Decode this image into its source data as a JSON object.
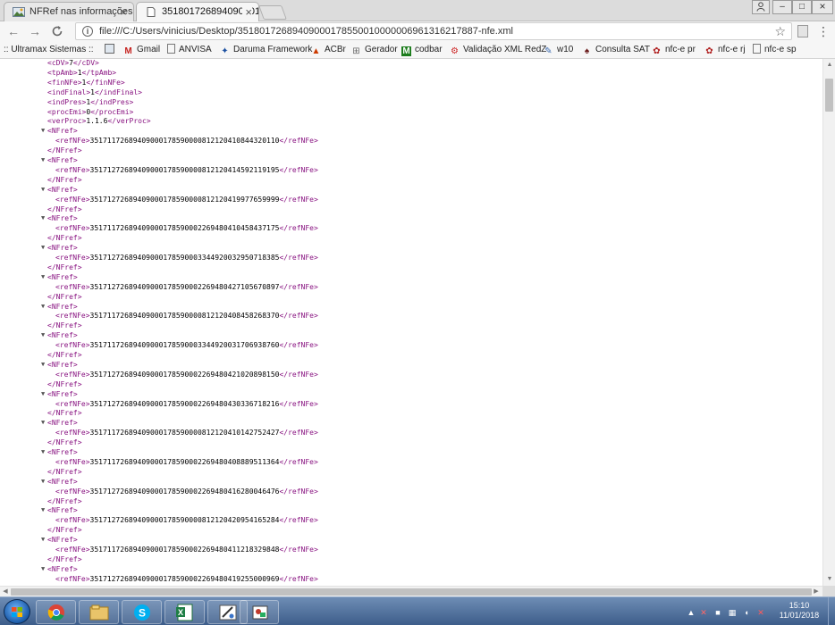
{
  "tabs": [
    {
      "label": "NFRef nas informações ce",
      "close": "×"
    },
    {
      "label": "3518017268940900017855001000000069613162178",
      "close": "×"
    }
  ],
  "window": {
    "user_icon": "user-icon",
    "min": "–",
    "max": "□",
    "close": "×"
  },
  "toolbar": {
    "back": "←",
    "forward": "→",
    "reload": "C",
    "url": "file:///C:/Users/vinicius/Desktop/35180172689409000178550010000006961316217887-nfe.xml",
    "info": "i",
    "star": "☆",
    "menu": "⋮"
  },
  "bookmarks": [
    {
      "label": ":: Ultramax Sistemas ::",
      "icon": "page-icon"
    },
    {
      "label": "",
      "icon": "image-icon"
    },
    {
      "label": "Gmail",
      "icon": "gmail-icon"
    },
    {
      "label": "ANVISA",
      "icon": "page-icon"
    },
    {
      "label": "Daruma Framework",
      "icon": "daruma-icon"
    },
    {
      "label": "ACBr",
      "icon": "acbr-icon"
    },
    {
      "label": "Gerador",
      "icon": "gerador-icon"
    },
    {
      "label": "codbar",
      "icon": "m-icon"
    },
    {
      "label": "Validação XML RedZ",
      "icon": "validacao-icon"
    },
    {
      "label": "w10",
      "icon": "w10-icon"
    },
    {
      "label": "Consulta SAT",
      "icon": "sat-icon"
    },
    {
      "label": "nfc-e pr",
      "icon": "nfce-icon"
    },
    {
      "label": "nfc-e rj",
      "icon": "nfce-icon"
    },
    {
      "label": "nfc-e sp",
      "icon": "page-icon"
    }
  ],
  "xml": {
    "header_lines": [
      {
        "open": "<cDV>",
        "value": "7",
        "close": "</cDV>"
      },
      {
        "open": "<tpAmb>",
        "value": "1",
        "close": "</tpAmb>"
      },
      {
        "open": "<finNFe>",
        "value": "1",
        "close": "</finNFe>"
      },
      {
        "open": "<indFinal>",
        "value": "1",
        "close": "</indFinal>"
      },
      {
        "open": "<indPres>",
        "value": "1",
        "close": "</indPres>"
      },
      {
        "open": "<procEmi>",
        "value": "0",
        "close": "</procEmi>"
      },
      {
        "open": "<verProc>",
        "value": "1.1.6",
        "close": "</verProc>"
      }
    ],
    "nfref_open": "<NFref>",
    "nfref_close": "</NFref>",
    "refnfe_open": "<refNFe>",
    "refnfe_close": "</refNFe>",
    "toggle": "▼",
    "refs": [
      "35171172689409000178590000812120410844320110",
      "35171272689409000178590000812120414592119195",
      "35171272689409000178590000812120419977659999",
      "35171172689409000178590002269480410458437175",
      "35171272689409000178590003344920032950718385",
      "35171272689409000178590002269480427105670897",
      "35171172689409000178590000812120408458268370",
      "35171172689409000178590003344920031706938760",
      "35171272689409000178590002269480421020898150",
      "35171272689409000178590002269480430336718216",
      "35171172689409000178590000812120410142752427",
      "35171172689409000178590002269480408889511364",
      "35171272689409000178590002269480416280046476",
      "35171272689409000178590000812120420954165284",
      "35171172689409000178590002269480411218329848",
      "35171272689409000178590002269480419255000969"
    ]
  },
  "taskbar": {
    "apps": [
      "chrome-icon",
      "explorer-icon",
      "skype-icon",
      "excel-icon",
      "paint-icon",
      "app-icon"
    ],
    "tray": [
      "arrow-up-icon",
      "flag-icon",
      "shield-icon",
      "network-icon",
      "volume-icon",
      "alert-icon"
    ],
    "tray_glyphs": [
      "▲",
      "✕",
      "■",
      "▦",
      "◖",
      "✕"
    ],
    "time": "15:10",
    "date": "11/01/2018"
  }
}
